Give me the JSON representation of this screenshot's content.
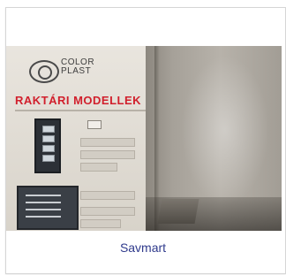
{
  "card": {
    "caption": "Savmart",
    "image": {
      "brand_line1": "COLOR",
      "brand_line2": "PLAST",
      "poster_title": "RAKTÁRI MODELLEK",
      "logo": "color-plast-logo"
    }
  },
  "colors": {
    "caption": "#2f3a8c",
    "poster_title": "#d11f2c",
    "card_border": "#d6d6d6"
  }
}
